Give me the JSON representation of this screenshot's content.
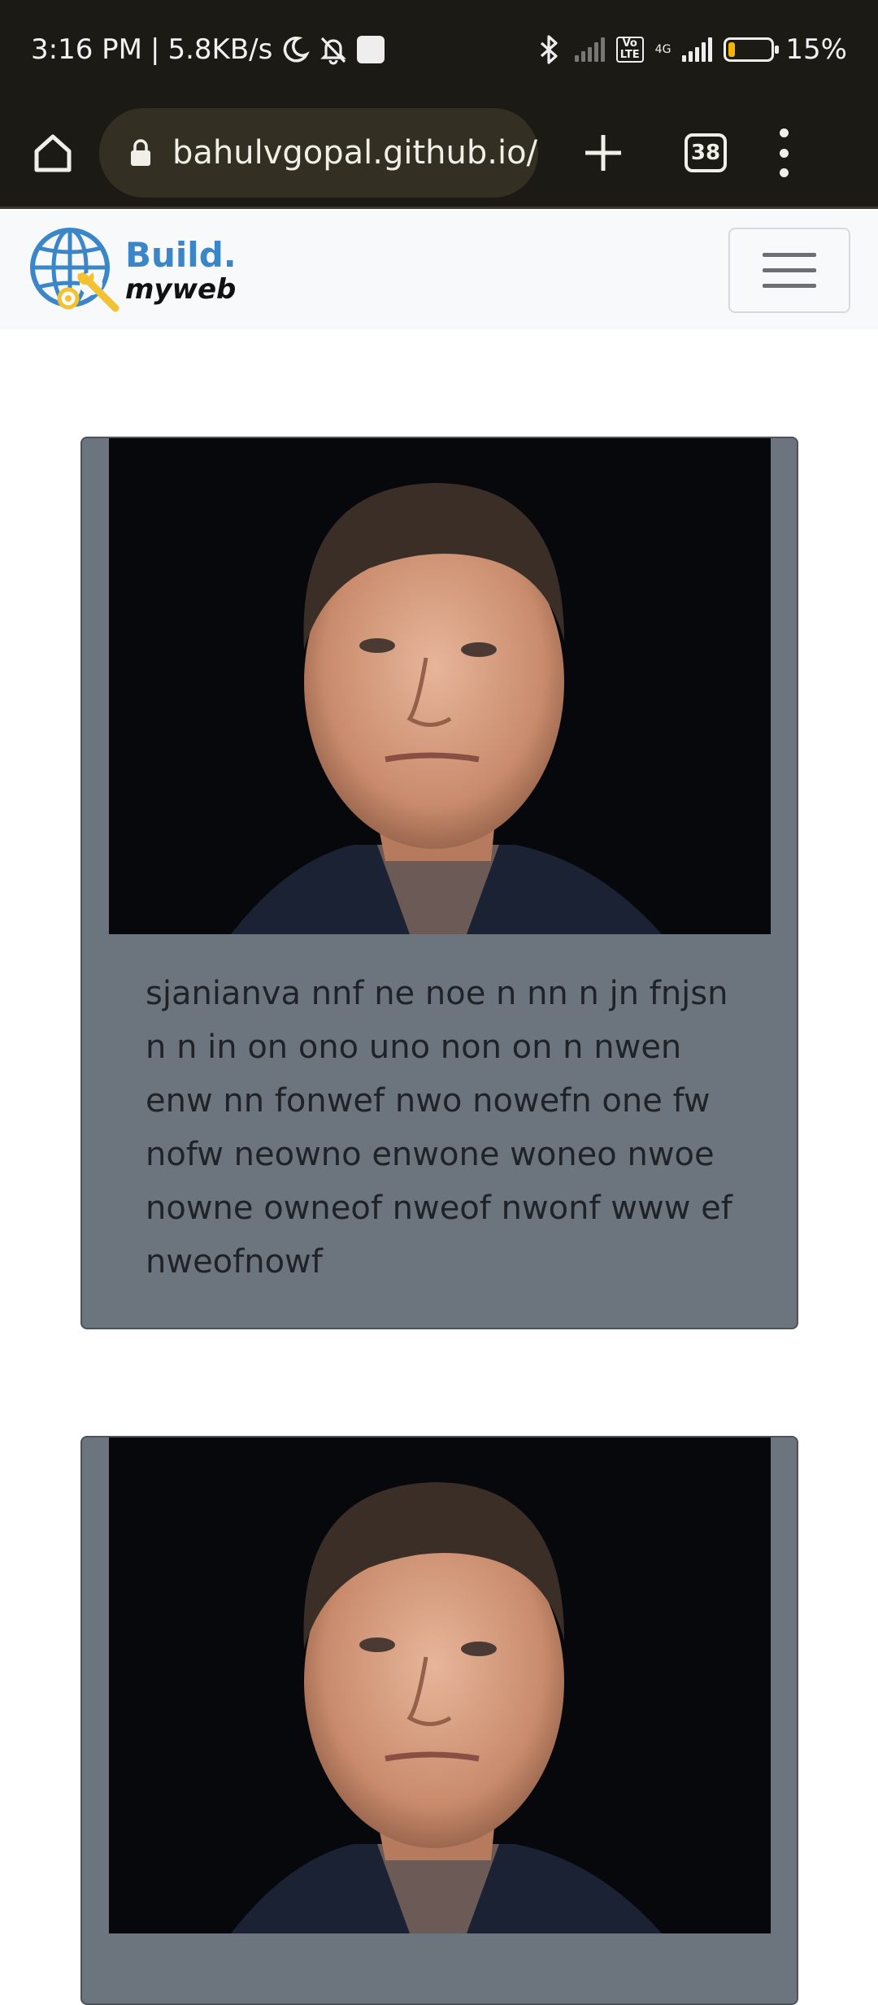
{
  "status_bar": {
    "time": "3:16 PM",
    "separator": "|",
    "speed": "5.8KB/s",
    "network": "4G",
    "volte": "Vo\nLTE",
    "battery": "15%",
    "battery_level": 0.15,
    "icons": [
      "moon-icon",
      "mute-bell-icon",
      "notification-square-icon",
      "bluetooth-icon",
      "signal-icon",
      "battery-icon"
    ]
  },
  "browser": {
    "url": "bahulvgopal.github.io/",
    "tab_count": "38",
    "icons": [
      "home-icon",
      "lock-icon",
      "plus-icon",
      "tabs-icon",
      "menu-dots-icon"
    ]
  },
  "site": {
    "brand_line1": "Build.",
    "brand_line2": "myweb",
    "brand_colors": {
      "blue": "#3a86c8",
      "yellow": "#f2c230"
    }
  },
  "cards": [
    {
      "image_alt": "portrait photo",
      "text": "sjanianva nnf ne noe n nn n jn fnjsn n n in on ono uno non on n nwen enw nn fonwef nwo nowefn one fw nofw neowno enwone woneo nwoe nowne owneof nweof nwonf www ef nweofnowf"
    },
    {
      "image_alt": "portrait photo",
      "text": ""
    }
  ],
  "colors": {
    "status_bg": "#1c1a14",
    "url_pill": "#332f22",
    "navbar_bg": "#f8f9fa",
    "card_bg": "#6c757d",
    "card_text": "#1f2328"
  }
}
